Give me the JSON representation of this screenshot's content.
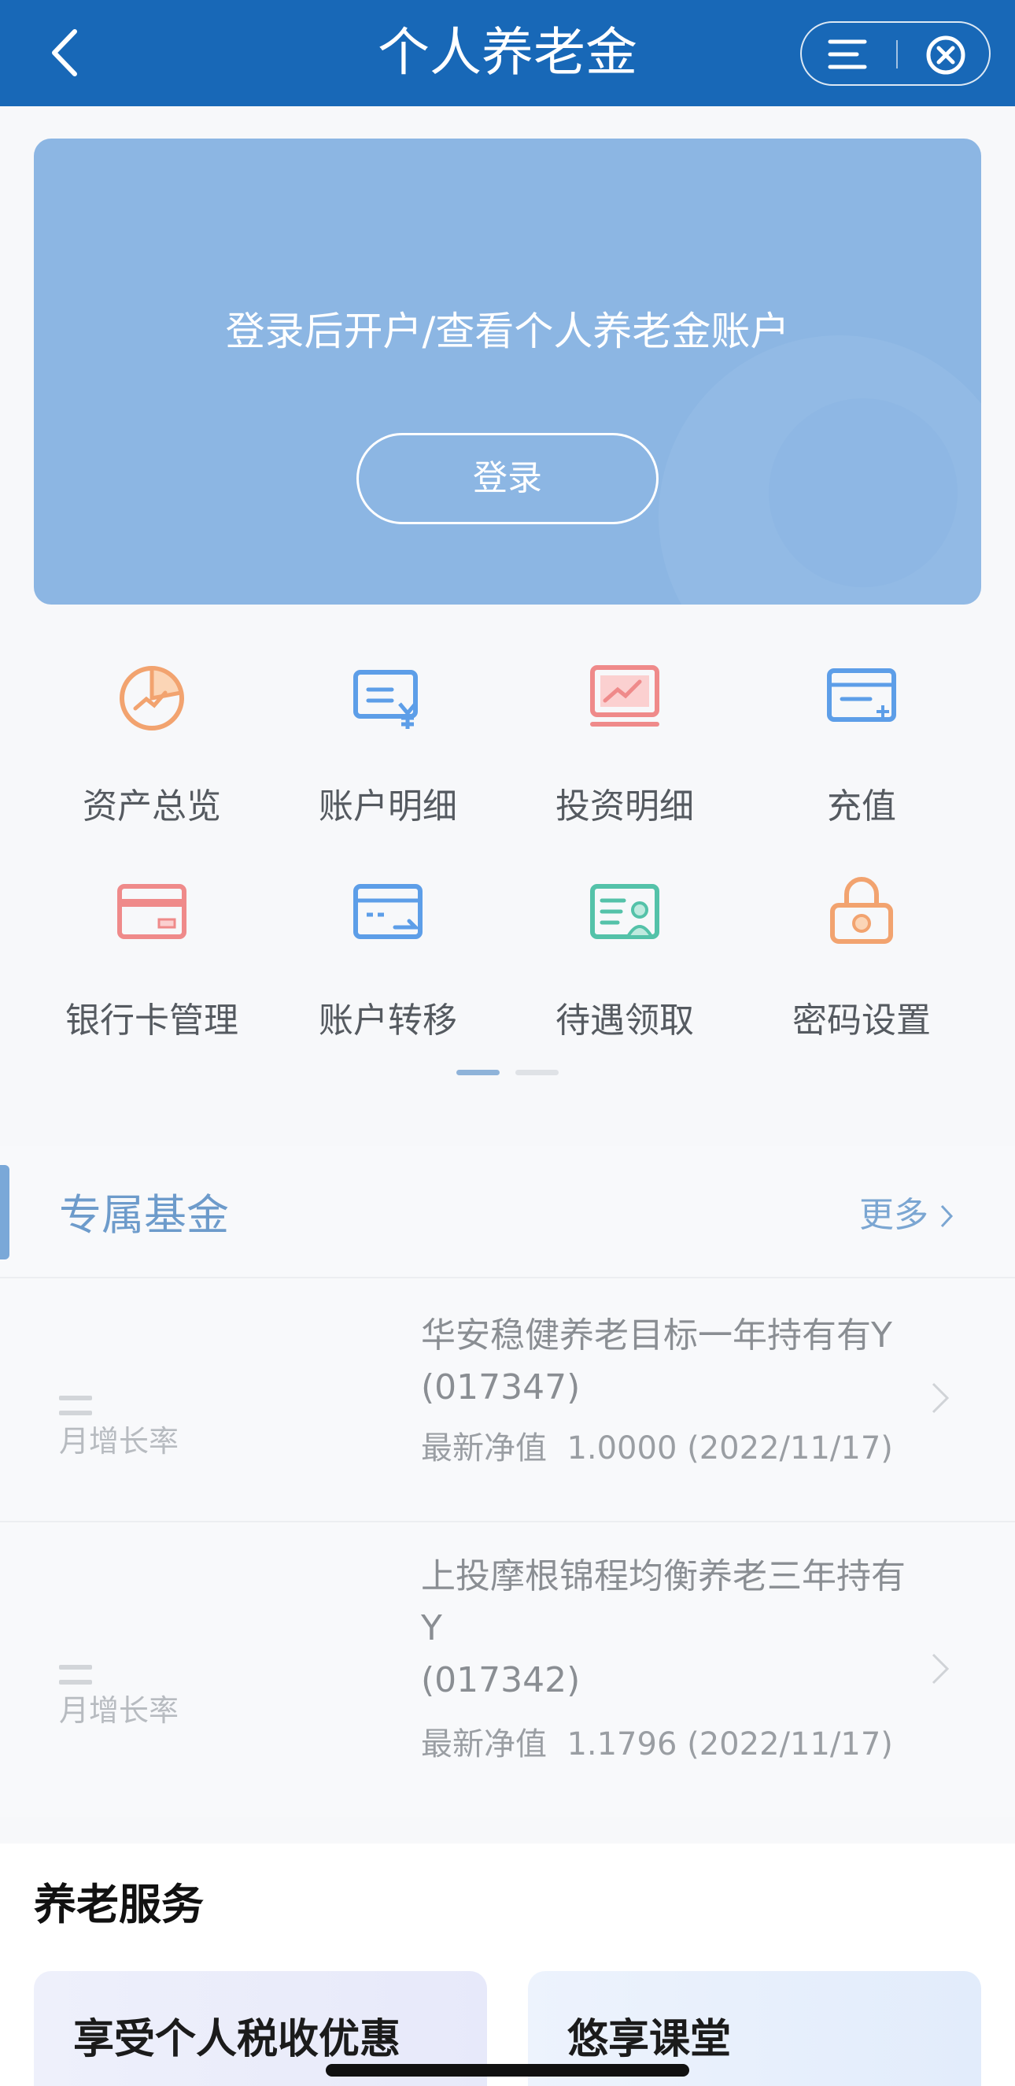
{
  "header": {
    "title": "个人养老金",
    "bg_color": "#1868b7"
  },
  "login": {
    "prompt": "登录后开户/查看个人养老金账户",
    "button_label": "登录"
  },
  "grid": {
    "items": [
      {
        "label": "资产总览",
        "icon": "asset-overview-icon",
        "color": "#f2a36f"
      },
      {
        "label": "账户明细",
        "icon": "account-detail-icon",
        "color": "#5d9ee8"
      },
      {
        "label": "投资明细",
        "icon": "investment-detail-icon",
        "color": "#ef8a8a"
      },
      {
        "label": "充值",
        "icon": "recharge-icon",
        "color": "#5d9ee8"
      },
      {
        "label": "银行卡管理",
        "icon": "bank-card-icon",
        "color": "#ef8a8a"
      },
      {
        "label": "账户转移",
        "icon": "account-transfer-icon",
        "color": "#5d9ee8"
      },
      {
        "label": "待遇领取",
        "icon": "benefit-claim-icon",
        "color": "#54c2a9"
      },
      {
        "label": "密码设置",
        "icon": "password-lock-icon",
        "color": "#f2a36f"
      }
    ]
  },
  "funds": {
    "section_title": "专属基金",
    "more_label": "更多",
    "items": [
      {
        "rate": "——",
        "rate_label": "月增长率",
        "name_lines": [
          "华安稳健养老目标一年持有有Y",
          "(017347)"
        ],
        "nav_label": "最新净值",
        "nav_value": "1.0000 (2022/11/17)"
      },
      {
        "rate": "——",
        "rate_label": "月增长率",
        "name_lines": [
          "上投摩根锦程均衡养老三年持有",
          "Y",
          "(017342)"
        ],
        "nav_label": "最新净值",
        "nav_value": "1.1796 (2022/11/17)"
      }
    ]
  },
  "services": {
    "title": "养老服务",
    "cards": [
      {
        "label": "享受个人税收优惠"
      },
      {
        "label": "悠享课堂"
      }
    ]
  }
}
